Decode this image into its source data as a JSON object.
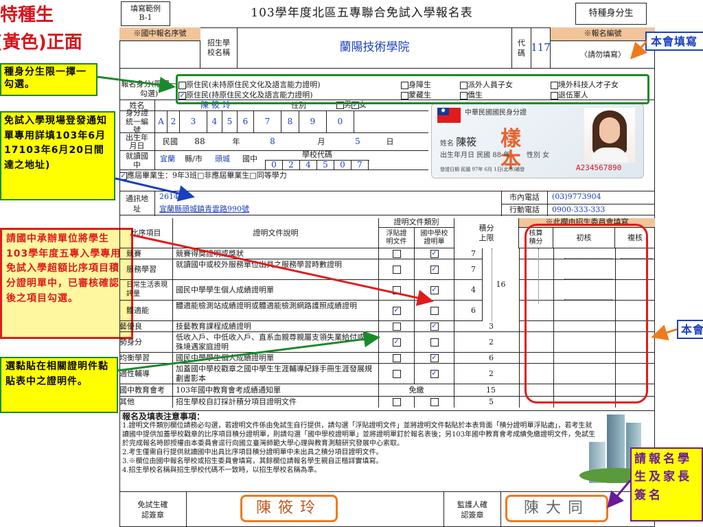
{
  "left_callouts": {
    "title_line1": "特種生",
    "title_line2": "(黃色)正面",
    "box1": "種身分生限一擇一勾選。",
    "box2": "免試入學現場登發通知單專用詳填103年6月17103年6月20日間達之地址)",
    "box3": "請國中承辦單位將學生103學年度五專入學專用免試入學超額比序項目積分證明單中，已審核確認後之項目勾選。",
    "box4": "選黏貼在相關證明件黏貼表中之證明件。"
  },
  "right_callouts": {
    "top": "本會填寫",
    "mid": "本會",
    "bottom": "請報名學生及家長簽名"
  },
  "header": {
    "sample_label": "填寫範例\nB-1",
    "title": "103學年度北區五專聯合免試入學報名表",
    "category": "特種身分生"
  },
  "school_row": {
    "seq_label": "※國中報名序號",
    "school_label": "招生學校名稱",
    "school_name": "蘭陽技術學院",
    "code_label": "代碼",
    "code": "117",
    "regno_label": "※報名編號",
    "regno_hint": "〈請勿填寫〉"
  },
  "identity": {
    "label": "報名身分(限擇一勾選)",
    "options": [
      {
        "text": "原住民(未持原住民文化及語言能力證明)",
        "checked": false
      },
      {
        "text": "原住民(持原住民文化及語言能力證明)",
        "checked": true
      },
      {
        "text": "身障生",
        "checked": false
      },
      {
        "text": "蒙藏生",
        "checked": false
      },
      {
        "text": "派外人員子女",
        "checked": false
      },
      {
        "text": "僑生",
        "checked": false
      },
      {
        "text": "境外科技人才子女",
        "checked": false
      },
      {
        "text": "退伍軍人",
        "checked": false
      }
    ]
  },
  "student": {
    "name_label": "姓名",
    "name": "陳筱玲",
    "gender_label": "性別",
    "male": "男",
    "female": "女",
    "gender_female_checked": true,
    "id_label": "身分證統一編號",
    "id_digits": [
      "A",
      "2",
      "3",
      "4",
      "5",
      "6",
      "7",
      "8",
      "9",
      "0"
    ],
    "dob_label": "出生年月日",
    "dob_era": "民國",
    "dob_year": "88",
    "year_unit": "年",
    "dob_month": "8",
    "month_unit": "月",
    "dob_day": "5",
    "day_unit": "日",
    "school_label": "就讀國中",
    "county": "宜蘭",
    "county_unit": "縣/市",
    "junior": "頭城",
    "junior_unit": "國中",
    "school_code_label": "學校代碼",
    "school_code": [
      "0",
      "2",
      "4",
      "5",
      "0",
      "7"
    ],
    "grad_text": "應屆畢業生：9年3班□非應屆畢業生□同等學力",
    "zip_label": "通訊地址",
    "zip": "26141",
    "address": "宜蘭縣頭城鎮青雲路990號",
    "tel_label": "市內電話",
    "tel": "(03)9773904",
    "mobile_label": "行動電話",
    "mobile": "0900-333-333"
  },
  "id_card": {
    "title": "中華民國國民身分證",
    "name_label": "姓名",
    "name": "陳筱",
    "stamp": "樣本",
    "dob_label": "出生年月日",
    "dob": "民國 88 年",
    "gender": "性別 女",
    "issue": "發證日期 民國 97年 6月 1日(北市)補發",
    "number": "A234567890"
  },
  "table": {
    "col_item": "比序項目",
    "col_desc": "證明文件說明",
    "col_type": "證明文件類別",
    "col_attach": "浮貼證明文件",
    "col_cert": "國中學校證明單",
    "col_max": "積分上限",
    "col_committee": "※此欄由招生委員會填寫",
    "col_score": "核算積分",
    "col_first": "初核",
    "col_second": "複核",
    "rows": [
      {
        "item": "競賽",
        "desc": "競賽得獎證明或獎狀",
        "attach": false,
        "cert": true,
        "max": "7"
      },
      {
        "item": "服務學習",
        "desc": "就讀國中或校外服務單位出具之服務學習時數證明",
        "attach": false,
        "cert": true,
        "max": "7"
      },
      {
        "item": "日常生活表現評量",
        "desc": "國民中學學生個人成績證明單",
        "attach": false,
        "cert": true,
        "max": "4"
      },
      {
        "item": "體適能",
        "desc": "體適能檢測站成績證明或體適能檢測網路護照成績證明",
        "attach": true,
        "cert": false,
        "max": "6"
      },
      {
        "item": "藝優良",
        "desc": "技藝教育課程成績證明",
        "attach": false,
        "cert": true,
        "max": "3"
      },
      {
        "item": "勢身分",
        "desc": "低收入戶、中低收入戶、直系血親尊親屬支領失業給付或特殊境遇家庭證明",
        "attach": true,
        "cert": false,
        "max": "2"
      },
      {
        "item": "均衡學習",
        "desc": "國民中學學生個人成績證明單",
        "attach": false,
        "cert": true,
        "max": "6"
      },
      {
        "item": "適性輔導",
        "desc": "加蓋國中學校戳章之國中學生生涯輔導紀錄手冊生涯發展規劃書影本",
        "attach": false,
        "cert": true,
        "max": "2"
      },
      {
        "item": "國中教育會考",
        "desc": "103年國中教育會考成績通知單",
        "exempt": "免繳",
        "max": "15"
      },
      {
        "item": "其他",
        "desc": "招生學校自訂採計積分項目證明文件",
        "attach": false,
        "cert": false,
        "max": "5"
      }
    ],
    "group_max": "16"
  },
  "notes": {
    "title": "報名及填表注意事項：",
    "lines": [
      "1.證明文件類別欄位請務必勾選，若證明文件係由免試生自行提供，請勾選「浮貼證明文件」並將證明文件黏貼於本表背面「積分證明單浮貼處」，若考生就讀國中提供加蓋學校戳章的比序項目積分證明單，則請勾選「國中學校證明單」並將證明單釘於報名表後；另103年國中教育會考成績免繳證明文件，免試生於完成報名時即授權由本委員會逕行向國立臺灣師範大學心理與教育測驗研究發展中心索取。",
      "2.考生僅需自行提供就讀國中出具比序項目積分證明單中未出具之積分項目證明文件。",
      "3.※欄位由國中報名學校或招生委員會填寫，其餘欄位請報名學生親自正楷詳實填寫。",
      "4.招生學校名稱與招生學校代碼不一致時，以招生學校名稱為準。"
    ]
  },
  "signatures": {
    "student_label": "免試生確認簽章",
    "student_sig": "陳筱玲",
    "guardian_label": "監護人確認簽章",
    "guardian_sig": "陳大同"
  },
  "colors": {
    "blue": "#1a3fbf",
    "red": "#d8141b",
    "green": "#1b8a2a",
    "orange": "#f07a1a",
    "yellow": "#ffff00",
    "purple": "#6a1a9a"
  }
}
